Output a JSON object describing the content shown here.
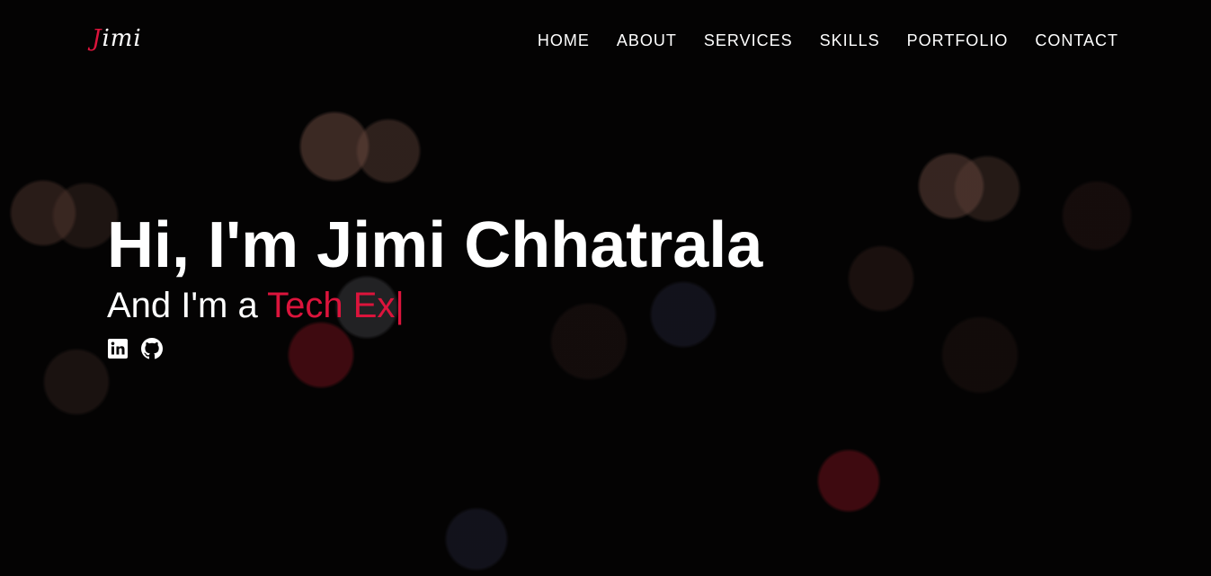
{
  "brand": {
    "logo_first_letter": "J",
    "logo_rest": "imi"
  },
  "nav": {
    "items": [
      {
        "label": "HOME"
      },
      {
        "label": "ABOUT"
      },
      {
        "label": "SERVICES"
      },
      {
        "label": "SKILLS"
      },
      {
        "label": "PORTFOLIO"
      },
      {
        "label": "CONTACT"
      }
    ]
  },
  "hero": {
    "title": "Hi, I'm Jimi Chhatrala",
    "subtitle_prefix": "And I'm a ",
    "typed_text": "Tech Ex",
    "cursor": "|",
    "socials": [
      {
        "icon": "linkedin-icon"
      },
      {
        "icon": "github-icon"
      }
    ]
  },
  "colors": {
    "accent": "#dc143c",
    "text": "#ffffff",
    "background": "#070606"
  }
}
